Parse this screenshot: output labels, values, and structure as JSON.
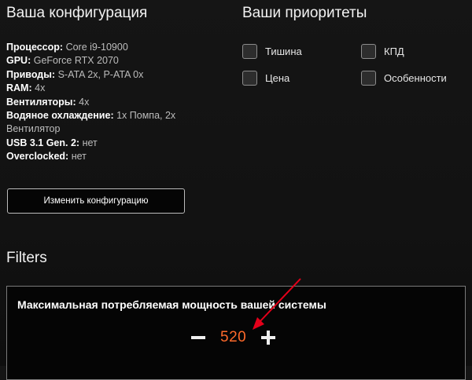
{
  "config": {
    "title": "Ваша конфигурация",
    "specs": [
      {
        "key": "Процессор:",
        "value": "Core i9-10900"
      },
      {
        "key": "GPU:",
        "value": "GeForce RTX 2070"
      },
      {
        "key": "Приводы:",
        "value": "S-ATA 2x, P-ATA 0x"
      },
      {
        "key": "RAM:",
        "value": "4x"
      },
      {
        "key": "Вентиляторы:",
        "value": "4x"
      },
      {
        "key": "Водяное охлаждение:",
        "value": "1x Помпа, 2x Вентилятор"
      },
      {
        "key": "USB 3.1 Gen. 2:",
        "value": "нет"
      },
      {
        "key": "Overclocked:",
        "value": "нет"
      }
    ],
    "change_button": "Изменить конфигурацию"
  },
  "priorities": {
    "title": "Ваши приоритеты",
    "items": [
      {
        "label": "Тишина",
        "checked": false
      },
      {
        "label": "КПД",
        "checked": false
      },
      {
        "label": "Цена",
        "checked": false
      },
      {
        "label": "Особенности",
        "checked": false
      }
    ]
  },
  "filters": {
    "title": "Filters",
    "power": {
      "title": "Максимальная потребляемая мощность вашей системы",
      "value": "520"
    }
  },
  "colors": {
    "accent": "#ff6a2b",
    "annotation_arrow": "#e4001a",
    "background": "#121212"
  },
  "icons": {
    "decrement": "minus-icon",
    "increment": "plus-icon"
  }
}
